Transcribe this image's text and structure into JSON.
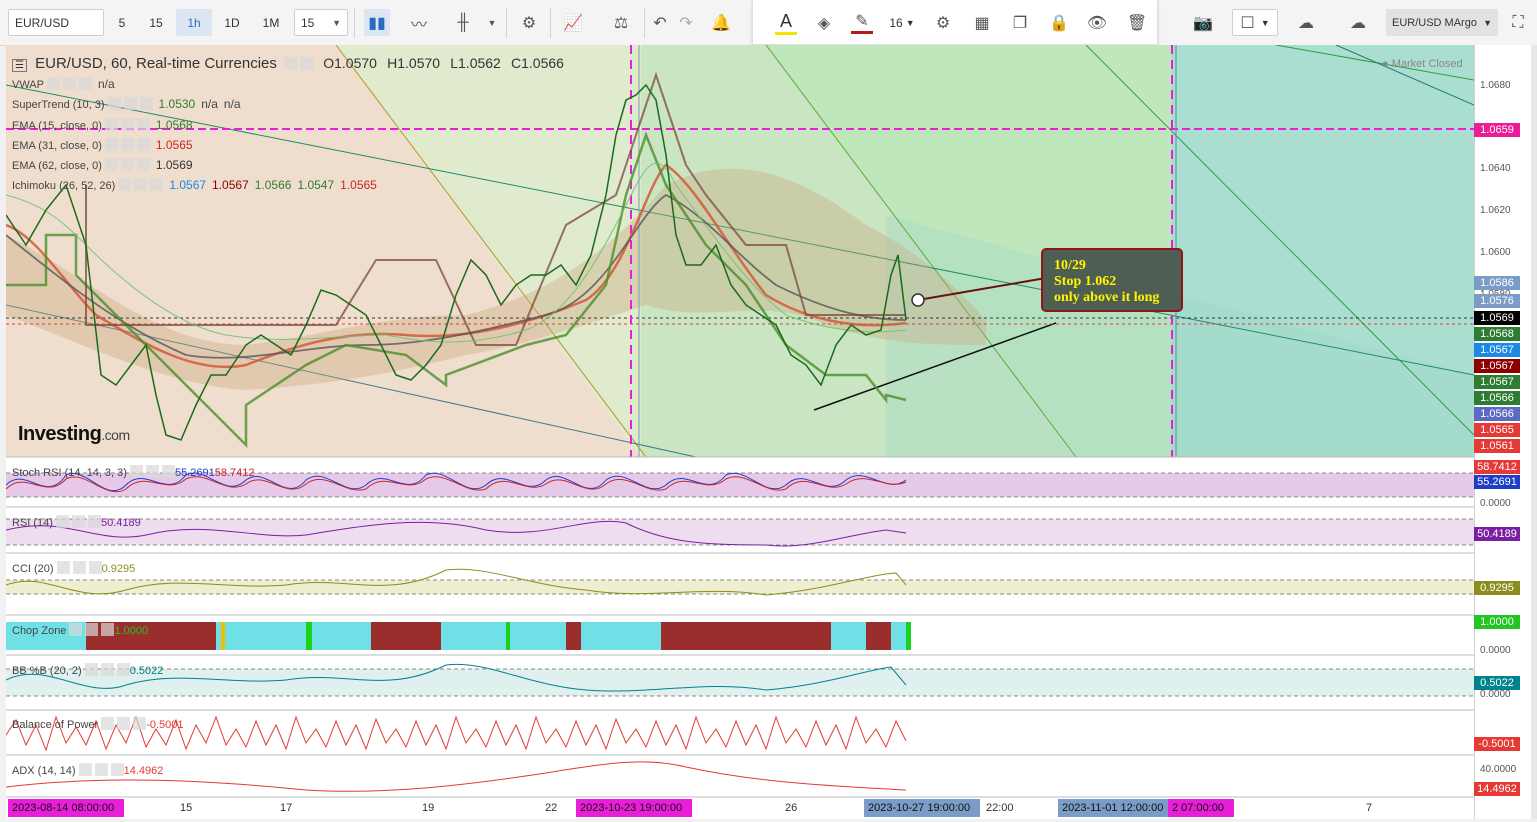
{
  "toolbar": {
    "symbol": "EUR/USD",
    "intervals": [
      "5",
      "15",
      "1h",
      "1D",
      "1M"
    ],
    "interval_selected": "1h",
    "interval_input": "15",
    "font_size": "16",
    "right_symbol": "EUR/USD MArgo"
  },
  "legend": {
    "title": "EUR/USD, 60, Real-time Currencies",
    "o": "O1.0570",
    "h": "H1.0570",
    "l": "L1.0562",
    "c": "C1.0566",
    "market": "Market Closed",
    "indicators": [
      {
        "name": "VWAP",
        "values": [
          "n/a"
        ],
        "colors": [
          "#444444"
        ]
      },
      {
        "name": "SuperTrend (10, 3)",
        "values": [
          "1.0530",
          "n/a",
          "n/a"
        ],
        "colors": [
          "#2e7d32",
          "#444444",
          "#444444"
        ]
      },
      {
        "name": "EMA (15, close, 0)",
        "values": [
          "1.0568"
        ],
        "colors": [
          "#2e7d32"
        ]
      },
      {
        "name": "EMA (31, close, 0)",
        "values": [
          "1.0565"
        ],
        "colors": [
          "#c62828"
        ]
      },
      {
        "name": "EMA (62, close, 0)",
        "values": [
          "1.0569"
        ],
        "colors": [
          "#333333"
        ]
      },
      {
        "name": "Ichimoku (26, 52, 26)",
        "values": [
          "1.0567",
          "1.0567",
          "1.0566",
          "1.0547",
          "1.0565"
        ],
        "colors": [
          "#1e88e5",
          "#8e0000",
          "#2e7d32",
          "#2e7d32",
          "#c62828"
        ]
      }
    ]
  },
  "annotation": {
    "line1": "10/29",
    "line2": "Stop 1.062",
    "line3": "only above it long"
  },
  "investing_logo": {
    "main": "Investing",
    "suffix": ".com"
  },
  "price_axis": {
    "ticks": [
      "1.0680",
      "1.0640",
      "1.0620",
      "1.0600",
      "1.0580"
    ],
    "boxes": [
      {
        "label": "1.0659",
        "bg": "#e91e96"
      },
      {
        "label": "1.0586",
        "bg": "#7a9cc6"
      },
      {
        "label": "1.0576",
        "bg": "#7a9cc6"
      },
      {
        "label": "1.0569",
        "bg": "#000000"
      },
      {
        "label": "1.0568",
        "bg": "#2e7d32"
      },
      {
        "label": "1.0567",
        "bg": "#1e88e5"
      },
      {
        "label": "1.0567",
        "bg": "#8e0000"
      },
      {
        "label": "1.0567",
        "bg": "#2e7d32"
      },
      {
        "label": "1.0566",
        "bg": "#2e7d32"
      },
      {
        "label": "1.0566",
        "bg": "#5c6bc0"
      },
      {
        "label": "1.0565",
        "bg": "#e53935"
      },
      {
        "label": "1.0561",
        "bg": "#e53935"
      }
    ]
  },
  "panels": [
    {
      "title": "Stoch RSI (14, 14, 3, 3)",
      "values": [
        "55.2691",
        "58.7412"
      ],
      "colors": [
        "#1e3ec8",
        "#c62828"
      ],
      "boxes": [
        {
          "label": "58.7412",
          "bg": "#e53935"
        },
        {
          "label": "55.2691",
          "bg": "#1e3ec8"
        }
      ],
      "ticks": [
        "0.0000"
      ]
    },
    {
      "title": "RSI (14)",
      "values": [
        "50.4189"
      ],
      "colors": [
        "#7b1fa2"
      ],
      "boxes": [
        {
          "label": "50.4189",
          "bg": "#7b1fa2"
        }
      ],
      "ticks": []
    },
    {
      "title": "CCI (20)",
      "values": [
        "0.9295"
      ],
      "colors": [
        "#8d8d1f"
      ],
      "boxes": [
        {
          "label": "0.9295",
          "bg": "#8d8d1f"
        }
      ],
      "ticks": []
    },
    {
      "title": "Chop Zone",
      "values": [
        "1.0000"
      ],
      "colors": [
        "#22c522"
      ],
      "boxes": [
        {
          "label": "1.0000",
          "bg": "#22c522"
        }
      ],
      "ticks": [
        "0.0000"
      ]
    },
    {
      "title": "BB %B (20, 2)",
      "values": [
        "0.5022"
      ],
      "colors": [
        "#00838f"
      ],
      "boxes": [
        {
          "label": "0.5022",
          "bg": "#00838f"
        }
      ],
      "ticks": [
        "0.0000"
      ]
    },
    {
      "title": "Balance of Power",
      "values": [
        "-0.5001"
      ],
      "colors": [
        "#e53935"
      ],
      "boxes": [
        {
          "label": "-0.5001",
          "bg": "#e53935"
        }
      ],
      "ticks": []
    },
    {
      "title": "ADX (14, 14)",
      "values": [
        "14.4962"
      ],
      "colors": [
        "#e53935"
      ],
      "boxes": [
        {
          "label": "14.4962",
          "bg": "#e53935"
        }
      ],
      "ticks": [
        "40.0000"
      ]
    }
  ],
  "time_axis": {
    "ticks": [
      "15",
      "17",
      "19",
      "22",
      "26",
      "22:00",
      "7"
    ],
    "boxes": [
      {
        "label": "2023-08-14 08:00:00",
        "bg": "#e91ed9"
      },
      {
        "label": "2023-10-23 19:00:00",
        "bg": "#e91ed9"
      },
      {
        "label": "2023-10-27 19:00:00",
        "bg": "#7a9cc6"
      },
      {
        "label": "2023-11-01 12:00:00",
        "bg": "#7a9cc6"
      },
      {
        "label": "2 07:00:00",
        "bg": "#e91ed9"
      }
    ]
  }
}
